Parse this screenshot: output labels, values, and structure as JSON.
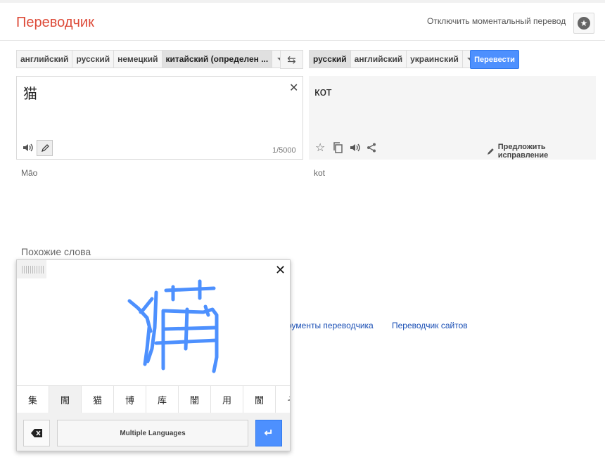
{
  "header": {
    "title": "Переводчик",
    "instant_toggle": "Отключить моментальный перевод"
  },
  "source_langs": [
    "английский",
    "русский",
    "немецкий",
    "китайский (определен ..."
  ],
  "target_langs": [
    "русский",
    "английский",
    "украинский"
  ],
  "translate_button": "Перевести",
  "source": {
    "text": "猫",
    "counter": "1/5000",
    "transliteration": "Māo"
  },
  "target": {
    "text": "кот",
    "transliteration": "kot",
    "suggest": "Предложить исправление"
  },
  "related_title": "Похожие слова",
  "links": [
    "рументы переводчика",
    "Переводчик сайтов"
  ],
  "handwriting": {
    "candidates": [
      "集",
      "閙",
      "猫",
      "博",
      "库",
      "闇",
      "用",
      "閬",
      "そ"
    ],
    "language_button": "Multiple Languages"
  },
  "colors": {
    "title": "#dd4b39",
    "accent": "#4d90fe",
    "ink": "#4d90fe"
  }
}
